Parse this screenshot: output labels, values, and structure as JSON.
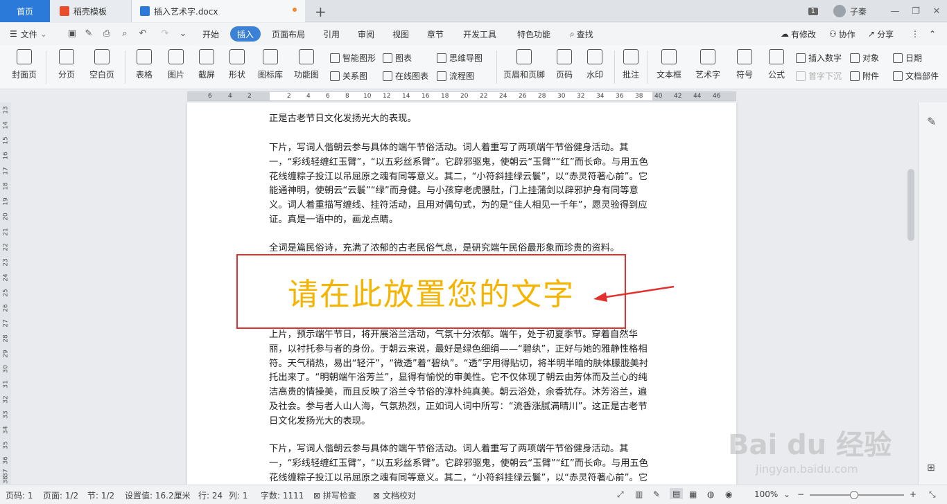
{
  "tabs": {
    "home": "首页",
    "template": "稻壳模板",
    "document": "插入艺术字.docx",
    "badge": "1",
    "username": "子秦"
  },
  "menu": {
    "file": "文件",
    "items": [
      "开始",
      "插入",
      "页面布局",
      "引用",
      "审阅",
      "视图",
      "章节",
      "开发工具",
      "特色功能"
    ],
    "search": "查找",
    "right": [
      "有修改",
      "协作",
      "分享"
    ]
  },
  "ribbon": {
    "cover": "封面页",
    "pagebreak": "分页",
    "blank": "空白页",
    "table": "表格",
    "picture": "图片",
    "screenshot": "截屏",
    "shape": "形状",
    "iconlib": "图标库",
    "funcchart": "功能图",
    "smartart": "智能图形",
    "chart": "图表",
    "mindmap": "思维导图",
    "relation": "关系图",
    "onlinechart": "在线图表",
    "flowchart": "流程图",
    "header": "页眉和页脚",
    "pagenum": "页码",
    "watermark": "水印",
    "comment": "批注",
    "textbox": "文本框",
    "wordart": "艺术字",
    "symbol": "符号",
    "formula": "公式",
    "insertnum": "插入数字",
    "object": "对象",
    "date": "日期",
    "dropcap": "首字下沉",
    "attachment": "附件",
    "docpart": "文档部件"
  },
  "ruler": [
    "6",
    "4",
    "2",
    "2",
    "4",
    "6",
    "8",
    "10",
    "12",
    "14",
    "16",
    "18",
    "20",
    "22",
    "24",
    "26",
    "28",
    "30",
    "32",
    "34",
    "36",
    "38",
    "40",
    "42",
    "44",
    "46"
  ],
  "vruler": [
    "13",
    "14",
    "15",
    "16",
    "17",
    "18",
    "19",
    "20",
    "21",
    "22",
    "23",
    "24",
    "25",
    "26",
    "27",
    "28",
    "29",
    "30",
    "31",
    "32",
    "33",
    "34",
    "35",
    "36",
    "37",
    "38"
  ],
  "document": {
    "p0": "正是古老节日文化发扬光大的表现。",
    "p1": "下片，写词人偕朝云参与具体的端午节俗活动。词人着重写了两项端午节俗健身活动。其一，“彩线轻缠红玉臂”，“以五彩丝系臂”。它辟邪驱鬼，使朝云“玉臂”“红”而长命。与用五色花线缠粽子投江以吊屈原之魂有同等意义。其二，“小符斜挂绿云鬟”，以“赤灵符著心前”。它能通神明，使朝云“云鬟”“绿”而身健。与小孩穿老虎腰肚，门上挂蒲剑以辟邪护身有同等意义。词人着重描写缠线、挂符活动，且用对偶句式，为的是“佳人相见一千年”，愿灵验得到应证。真是一语中的，画龙点睛。",
    "p2": "全词是篇民俗诗，充满了浓郁的古老民俗气息，是研究端午民俗最形象而珍贵的资料。",
    "wordart": "请在此放置您的文字",
    "p3": "上片，预示端午节日，将开展浴兰活动，气氛十分浓郁。端午，处于初夏季节。穿着自然华丽，以衬托参与者的身份。于朝云来说，最好是绿色细绢——“碧纨”，正好与她的雅静性格相符。天气稍热，易出“轻汗”，“微透”着“碧纨”。“透”字用得贴切，将半明半暗的肤体朦胧美衬托出来了。“明朝端午浴芳兰”，显得有愉悦的审美性。它不仅体现了朝云由芳体而及兰心的纯洁高贵的情操美，而且反映了浴兰令节俗的淳朴纯真美。朝云浴处，余香犹存。沐芳浴兰，遍及社会。参与者人山人海，气氛热烈，正如词人词中所写：“流香涨腻满晴川”。这正是古老节日文化发扬光大的表现。",
    "p4": "下片，写词人偕朝云参与具体的端午节俗活动。词人着重写了两项端午节俗健身活动。其一，“彩线轻缠红玉臂”，“以五彩丝系臂”。它辟邪驱鬼，使朝云“玉臂”“红”而长命。与用五色花线缠粽子投江以吊屈原之魂有同等意义。其二，“小符斜挂绿云鬟”，以“赤灵符著心前”。它"
  },
  "status": {
    "page": "页码: 1",
    "pages": "页面: 1/2",
    "section": "节: 1/2",
    "setting": "设置值: 16.2厘米",
    "row": "行: 24",
    "col": "列: 1",
    "words": "字数: 1111",
    "spell": "拼写检查",
    "proof": "文档校对",
    "zoom": "100%"
  },
  "watermark": {
    "main": "Bai du 经验",
    "sub": "jingyan.baidu.com"
  },
  "colors": {
    "accent": "#3b82d6",
    "wordart": "#f5b400",
    "annotation": "#e0312f"
  }
}
